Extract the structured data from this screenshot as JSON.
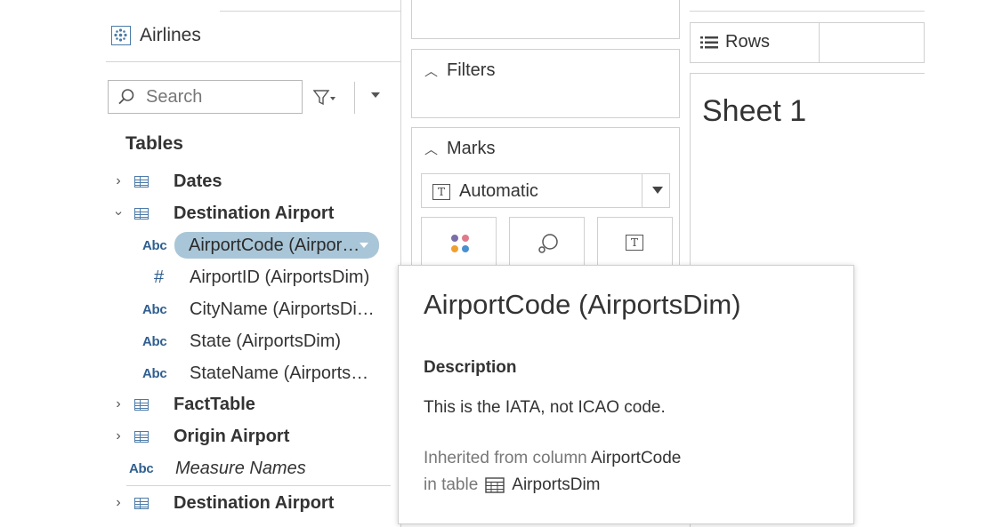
{
  "datasource": {
    "name": "Airlines"
  },
  "search": {
    "placeholder": "Search"
  },
  "tables_header": "Tables",
  "tree": {
    "dates": "Dates",
    "dest_airport": "Destination Airport",
    "fields": [
      {
        "type": "Abc",
        "label": "AirportCode (Airpor…"
      },
      {
        "type": "#",
        "label": "AirportID (AirportsDim)"
      },
      {
        "type": "Abc",
        "label": "CityName (AirportsDi…"
      },
      {
        "type": "Abc",
        "label": "State (AirportsDim)"
      },
      {
        "type": "Abc",
        "label": "StateName (Airports…"
      }
    ],
    "fact_table": "FactTable",
    "origin_airport": "Origin Airport",
    "measure_names_type": "Abc",
    "measure_names": "Measure Names",
    "dest_airport_2": "Destination Airport"
  },
  "filters": {
    "label": "Filters"
  },
  "marks": {
    "label": "Marks",
    "type": "Automatic"
  },
  "rows": {
    "label": "Rows"
  },
  "sheet": {
    "title": "Sheet 1"
  },
  "tooltip": {
    "title": "AirportCode (AirportsDim)",
    "description_heading": "Description",
    "description": "This is the IATA, not ICAO code.",
    "inherited_prefix": "Inherited from column",
    "inherited_column": "AirportCode",
    "table_prefix": "in table",
    "table_name": "AirportsDim"
  },
  "colors": {
    "pill": "#a9c6d8",
    "accent": "#4b7aa8"
  }
}
